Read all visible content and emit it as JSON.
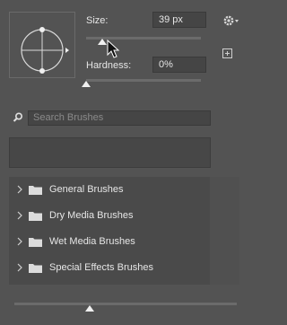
{
  "brush": {
    "size_label": "Size:",
    "size_value": "39 px",
    "size_level_percent": 14,
    "hardness_label": "Hardness:",
    "hardness_value": "0%",
    "hardness_level_percent": 0
  },
  "search": {
    "placeholder": "Search Brushes"
  },
  "folders": [
    {
      "label": "General Brushes"
    },
    {
      "label": "Dry Media Brushes"
    },
    {
      "label": "Wet Media Brushes"
    },
    {
      "label": "Special Effects Brushes"
    }
  ],
  "preview_size_level_percent": 34,
  "icons": {
    "settings": "gear-icon",
    "new_preset": "plus-square-icon",
    "search": "search-icon",
    "folder": "folder-icon",
    "chevron": "chevron-right-icon"
  },
  "colors": {
    "panel": "#535353",
    "field": "#454545",
    "text": "#e6e6e6"
  }
}
